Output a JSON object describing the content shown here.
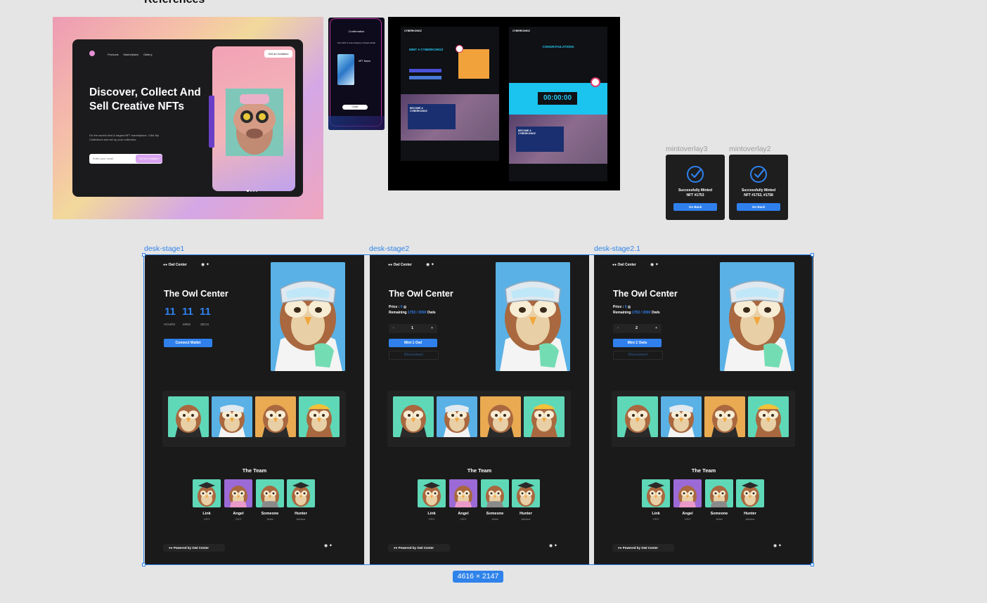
{
  "section_heading": "References",
  "reference_1": {
    "nav": [
      "Products",
      "Marketplace",
      "Gallery"
    ],
    "invite_button": "Get an invitation",
    "headline": "Discover, Collect And Sell Creative NFTs",
    "subtext": "On the world's first & largest NFT marketplace. Click My Collections and set up your collection.",
    "email_placeholder": "Enter your email",
    "email_button": "Get an invitation"
  },
  "reference_2": {
    "header": "Confirmation",
    "message": "Your NFT is now minted on Tempo Chain",
    "nft_name": "NFT Name",
    "button": "Close"
  },
  "reference_3": {
    "brand": "CYBERKONGZ",
    "left_title": "MINT A CYBERKONGZ",
    "right_title": "CONGRATULATIONS",
    "countdown": "00:00:00",
    "promo": "BECOME A CYBERKONGZ"
  },
  "overlays": [
    {
      "label": "mintoverlay3",
      "message_line1": "Successfully Minted",
      "message_line2": "NFT #1753",
      "button": "Go Back"
    },
    {
      "label": "mintoverlay2",
      "message_line1": "Successfully Minted",
      "message_line2": "NFT #1753, #1758",
      "button": "Go Back"
    }
  ],
  "shared": {
    "logo_text": "Owl Center",
    "title": "The Owl Center",
    "team_title": "The Team",
    "footer_text": "Powered by Owl Center",
    "team": [
      {
        "name": "Link",
        "role": "CEO"
      },
      {
        "name": "Angel",
        "role": "CEO"
      },
      {
        "name": "Someone",
        "role": "Artist"
      },
      {
        "name": "Hunter",
        "role": "Advisor"
      }
    ]
  },
  "stage1": {
    "label": "desk-stage1",
    "countdown": [
      {
        "value": "11",
        "unit": "HOURS"
      },
      {
        "value": "11",
        "unit": "MINS"
      },
      {
        "value": "11",
        "unit": "SECS"
      }
    ],
    "connect_button": "Connect Wallet"
  },
  "stage2": {
    "label": "desk-stage2",
    "price_label": "Price :",
    "price_value": "0",
    "remaining_label": "Remaining",
    "remaining_value": "1753 / 3000",
    "remaining_suffix": "Owls",
    "quantity": "1",
    "mint_button": "Mint 1 Owl",
    "disconnect_button": "Disconnect"
  },
  "stage21": {
    "label": "desk-stage2.1",
    "price_label": "Price :",
    "price_value": "0",
    "remaining_label": "Remaining",
    "remaining_value": "1753 / 3000",
    "remaining_suffix": "Owls",
    "quantity": "2",
    "mint_button": "Mint 2 Owls",
    "disconnect_button": "Disconnect"
  },
  "selection_dimensions": "4616 × 2147",
  "colors": {
    "canvas": "#e5e5e5",
    "frame_bg": "#1a1a1a",
    "accent_blue": "#2f80ed",
    "owl_tile_green": "#5fd8b8",
    "owl_tile_blue": "#59b1e6",
    "owl_tile_orange": "#e9aa52",
    "owl_tile_purple": "#9b6ad6"
  }
}
